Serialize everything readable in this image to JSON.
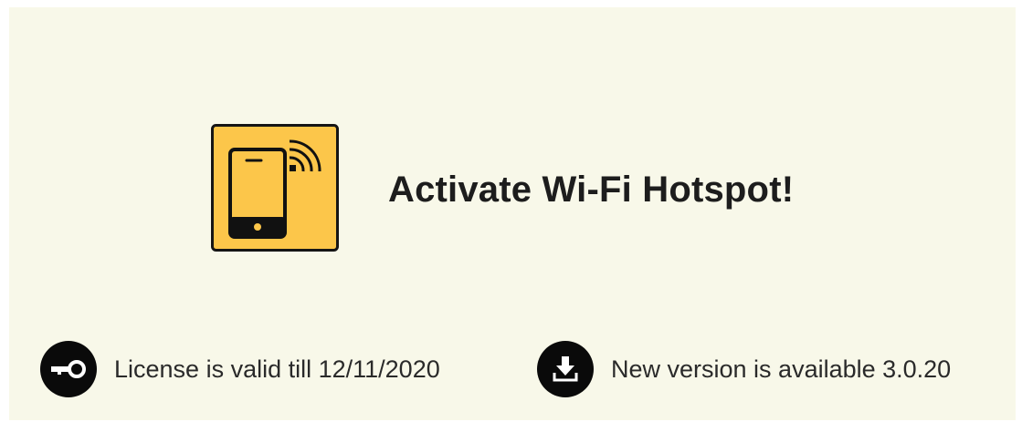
{
  "hotspot": {
    "title": "Activate Wi-Fi Hotspot!",
    "icon": "phone-wifi-icon",
    "icon_color": "#fcc64a"
  },
  "license": {
    "icon": "key-icon",
    "text": "License is valid till 12/11/2020"
  },
  "update": {
    "icon": "download-icon",
    "text": "New version is available 3.0.20"
  }
}
